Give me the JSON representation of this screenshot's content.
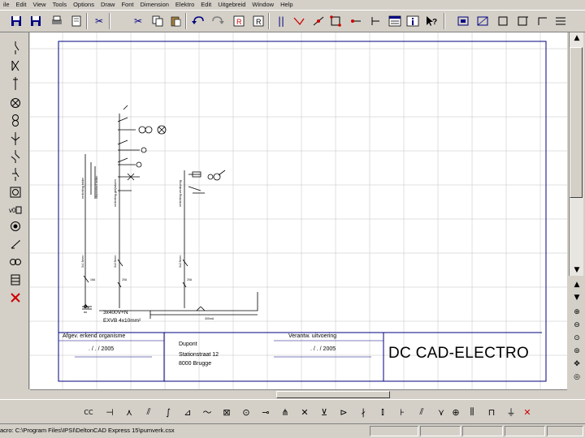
{
  "menu": [
    "ile",
    "Edit",
    "View",
    "Tools",
    "Options",
    "Draw",
    "Font",
    "Dimension",
    "Elektro",
    "Edit",
    "Uitgebreid",
    "Window",
    "Help"
  ],
  "titleblock": {
    "org_label": "Afgev. erkend organisme",
    "org_date": ". / . / 2005",
    "client_name": "Dupont",
    "client_street": "Stationstraat 12",
    "client_city": "8000 Brugge",
    "resp_label": "Verantw. uitvoering",
    "resp_date": ". / . / 2005",
    "brand": "DC CAD-ELECTRO"
  },
  "diagram": {
    "feed_label": "3x400V+N",
    "feed_sublabel": "EXVB 4x10mm²"
  },
  "status": {
    "path": "acro: C:\\Program Files\\IPSI\\DeltonCAD Express 15\\pumverk.csx"
  },
  "colors": {
    "frame": "#000080",
    "grid": "#c0c0c0",
    "circuit": "#000000",
    "toolbar_bg": "#d4d0c8",
    "delete_red": "#cc0000"
  },
  "icons": {
    "top": [
      "save-icon",
      "open-icon",
      "copy-icon",
      "paste-icon",
      "undo-icon",
      "redo-icon",
      "text-icon",
      "line-icon",
      "node-icon",
      "help-icon"
    ],
    "left": [
      "switch-icon",
      "contact-icon",
      "fuse-icon",
      "lamp-icon",
      "motor-icon",
      "socket-icon",
      "delete-icon"
    ],
    "bottom": [
      "contactor-icon",
      "relay-icon",
      "breaker-icon",
      "terminal-icon",
      "delete-icon"
    ]
  }
}
